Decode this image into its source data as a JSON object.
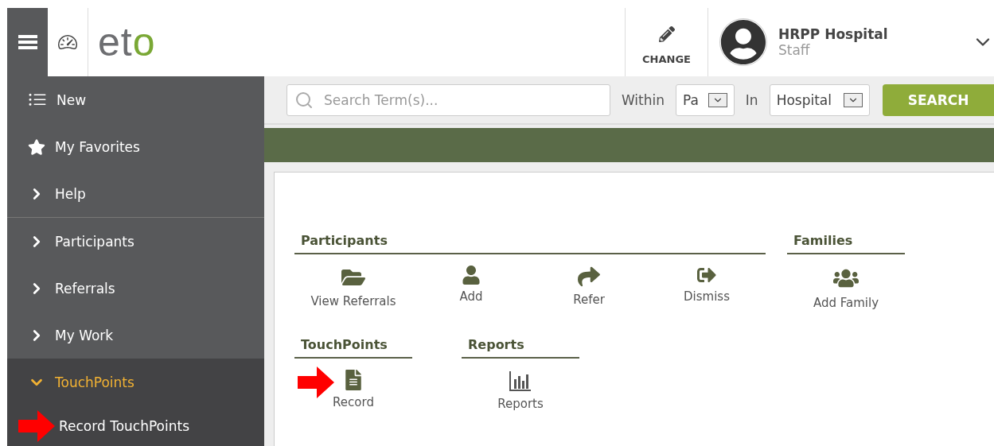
{
  "header": {
    "logo": "eto",
    "change_button": "CHANGE",
    "user": {
      "name": "HRPP Hospital",
      "role": "Staff"
    }
  },
  "sidebar": {
    "items": [
      {
        "kind": "link",
        "label": "New"
      },
      {
        "kind": "link",
        "label": "My Favorites"
      },
      {
        "kind": "group",
        "label": "Help",
        "expanded": false,
        "divider_after": true
      },
      {
        "kind": "group",
        "label": "Participants",
        "expanded": false
      },
      {
        "kind": "group",
        "label": "Referrals",
        "expanded": false
      },
      {
        "kind": "group",
        "label": "My Work",
        "expanded": false
      },
      {
        "kind": "group",
        "label": "TouchPoints",
        "expanded": true,
        "children": [
          {
            "label": "Record TouchPoints",
            "pointed": true
          }
        ]
      }
    ]
  },
  "search": {
    "placeholder": "Search Term(s)...",
    "within_label": "Within",
    "within_value": "Pa",
    "in_label": "In",
    "in_value": "Hospital",
    "button": "SEARCH"
  },
  "sections": [
    [
      {
        "title": "Participants",
        "items": [
          "View Referrals",
          "Add",
          "Refer",
          "Dismiss"
        ]
      },
      {
        "title": "Families",
        "items": [
          "Add Family"
        ]
      }
    ],
    [
      {
        "title": "TouchPoints",
        "items": [
          "Record"
        ],
        "pointed": true
      },
      {
        "title": "Reports",
        "items": [
          "Reports"
        ]
      }
    ]
  ]
}
